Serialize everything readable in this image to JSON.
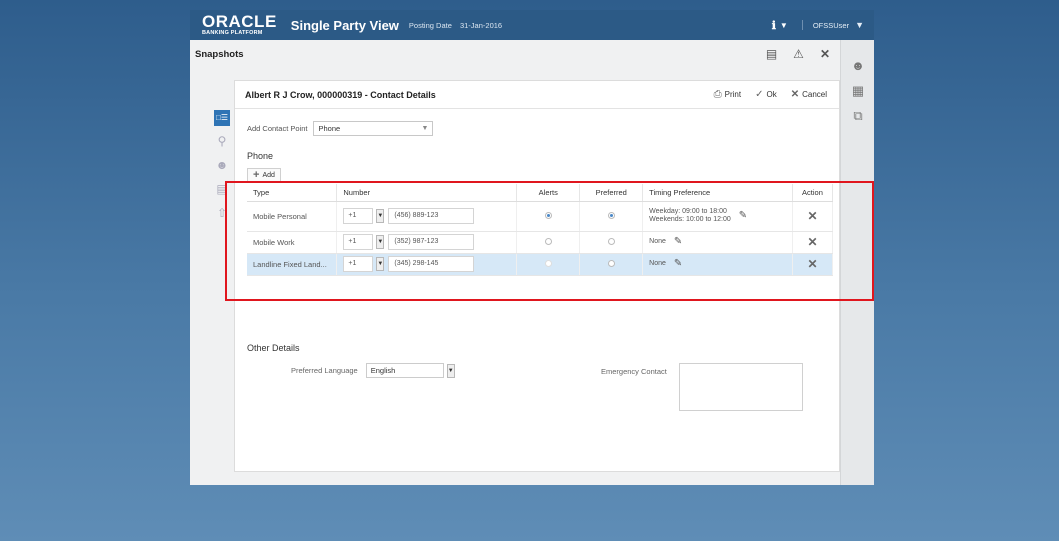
{
  "header": {
    "logo_main": "ORACLE",
    "logo_sub": "BANKING PLATFORM",
    "app_title": "Single Party View",
    "posting_label": "Posting Date",
    "posting_date": "31-Jan-2016",
    "user": "OFSSUser"
  },
  "snapshots": {
    "title": "Snapshots"
  },
  "panel": {
    "title": "Albert R J Crow, 000000319 - Contact Details",
    "print_label": "Print",
    "ok_label": "Ok",
    "cancel_label": "Cancel"
  },
  "contact_point": {
    "label": "Add Contact Point",
    "value": "Phone"
  },
  "phone": {
    "section_label": "Phone",
    "add_label": "Add",
    "columns": [
      "Type",
      "Number",
      "Alerts",
      "Preferred",
      "Timing Preference",
      "Action"
    ],
    "rows": [
      {
        "type": "Mobile Personal",
        "cc": "+1",
        "number": "(456) 889-123",
        "alerts": true,
        "preferred": true,
        "timing1": "Weekday: 09:00 to 18:00",
        "timing2": "Weekends: 10:00 to 12:00"
      },
      {
        "type": "Mobile Work",
        "cc": "+1",
        "number": "(352) 987-123",
        "alerts": false,
        "preferred": false,
        "timing1": "None",
        "timing2": ""
      },
      {
        "type": "Landline Fixed Land...",
        "cc": "+1",
        "number": "(345) 298-145",
        "alerts": false,
        "preferred": false,
        "timing1": "None",
        "timing2": ""
      }
    ]
  },
  "other": {
    "title": "Other Details",
    "pref_lang_label": "Preferred Language",
    "pref_lang_value": "English",
    "emergency_label": "Emergency Contact"
  },
  "colors": {
    "header": "#2c5a86",
    "selected_row": "#d6e8f7",
    "highlight_border": "#e0161e",
    "accent": "#2e74b5"
  }
}
